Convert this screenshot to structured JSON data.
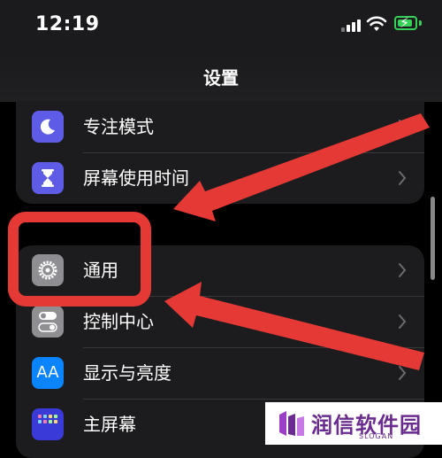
{
  "status_bar": {
    "time": "12:19",
    "battery_color": "#37d159"
  },
  "header": {
    "title": "设置"
  },
  "settings_groups": [
    {
      "items": [
        {
          "label": "专注模式",
          "icon": "moon-icon",
          "icon_bg": "#5e5ce6"
        },
        {
          "label": "屏幕使用时间",
          "icon": "hourglass-icon",
          "icon_bg": "#5e5ce6"
        }
      ]
    },
    {
      "items": [
        {
          "label": "通用",
          "icon": "gear-icon",
          "icon_bg": "#8e8e93"
        },
        {
          "label": "控制中心",
          "icon": "toggles-icon",
          "icon_bg": "#8e8e93"
        },
        {
          "label": "显示与亮度",
          "icon": "text-size-icon",
          "icon_bg": "#0a84ff"
        },
        {
          "label": "主屏幕",
          "icon": "home-screen-grid-icon",
          "icon_bg": "#3a3ad8"
        }
      ]
    }
  ],
  "annotation": {
    "color": "#e53935",
    "highlighted_item": "通用"
  },
  "watermark": {
    "text": "润信软件园",
    "slogan": "SLOGAN",
    "color": "#6a2c8e"
  }
}
